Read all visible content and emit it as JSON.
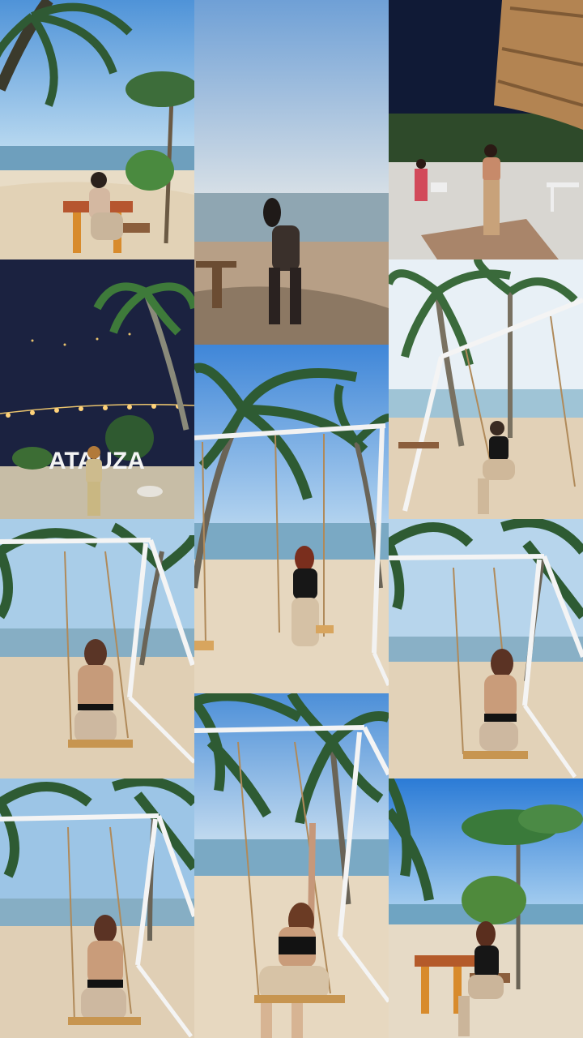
{
  "collage": {
    "tiles": [
      {
        "id": "beach-table-girl"
      },
      {
        "id": "shoreline-standing-girl"
      },
      {
        "id": "night-patio-girl"
      },
      {
        "id": "atauza-sign-night"
      },
      {
        "id": "swing-wide-empty"
      },
      {
        "id": "swing-diagonal-sitting"
      },
      {
        "id": "swing-back-view-left"
      },
      {
        "id": "swing-front-sitting"
      },
      {
        "id": "swing-back-view-right"
      },
      {
        "id": "swing-back-view-bottom-left"
      },
      {
        "id": "swing-arm-raised"
      },
      {
        "id": "beach-table-bottom-right"
      }
    ]
  },
  "sign": {
    "text": "ATAUZA",
    "color": "#f4f4f4"
  },
  "palette": {
    "sky_day": "#7fb6e6",
    "sea": "#7aa9c4",
    "sand": "#e6d7bf",
    "night_sky": "#17213e",
    "palm": "#2f5a34"
  }
}
